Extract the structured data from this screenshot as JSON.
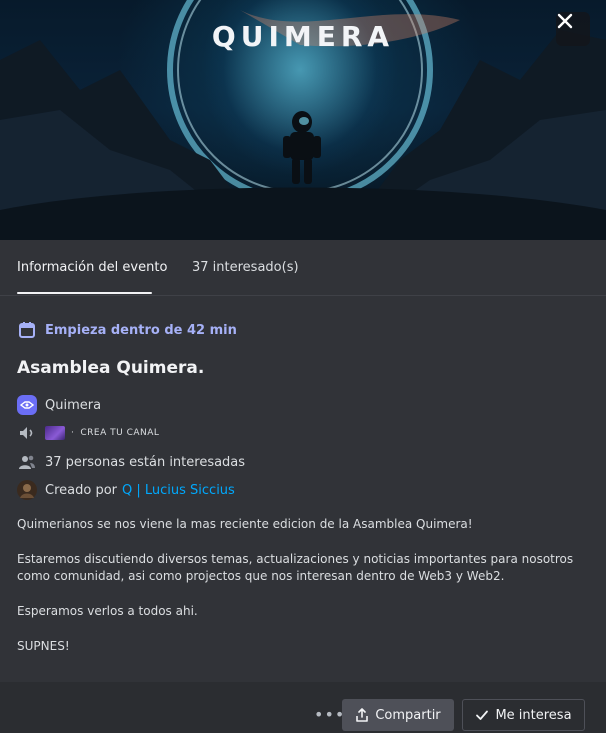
{
  "banner": {
    "logo_text": "QUIMERA"
  },
  "tabs": [
    {
      "label": "Información del evento"
    },
    {
      "label": "37 interesado(s)"
    }
  ],
  "event": {
    "start_text": "Empieza dentro de 42 min",
    "title": "Asamblea Quimera.",
    "server_name": "Quimera",
    "channel_separator": "·",
    "channel_name": "CREA TU CANAL",
    "interested_text": "37 personas están interesadas",
    "created_by_prefix": "Creado por",
    "creator": "Q | Lucius Siccius"
  },
  "description": [
    "Quimerianos se nos viene la mas reciente edicion de la Asamblea Quimera!",
    "Estaremos discutiendo diversos temas, actualizaciones y noticias importantes para nosotros como comunidad, asi como projectos que nos interesan dentro de Web3 y Web2.",
    "Esperamos verlos a todos ahi.",
    "SUPNES!"
  ],
  "footer": {
    "more_label": "•••",
    "share_label": "Compartir",
    "interest_label": "Me interesa"
  },
  "colors": {
    "accent": "#a6b1f7",
    "link": "#00a8fc",
    "background": "#313338"
  },
  "icons": [
    "close-icon",
    "calendar-icon",
    "server-icon",
    "speaker-icon",
    "people-icon",
    "avatar",
    "share-icon",
    "check-icon",
    "more-icon"
  ]
}
